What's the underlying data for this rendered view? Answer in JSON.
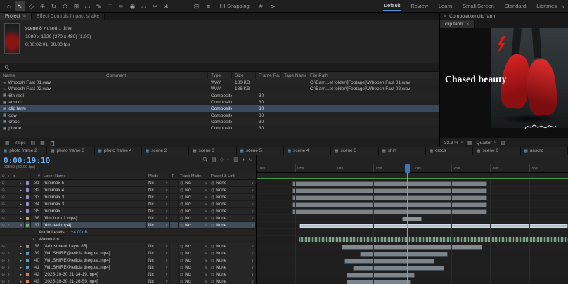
{
  "colors": {
    "accent": "#4a8fd8",
    "timecode_blue": "#6ab0f0",
    "render_bar_green": "#3f9b3f",
    "audio_value_blue": "#4f9fe8",
    "boot_red": "#c01818"
  },
  "toolbar": {
    "tools": [
      {
        "name": "home-icon",
        "glyph": "⌂"
      },
      {
        "name": "selection-tool-icon",
        "glyph": "↖",
        "active": true
      },
      {
        "name": "hand-tool-icon",
        "glyph": "◇"
      },
      {
        "name": "zoom-tool-icon",
        "glyph": "⊕"
      },
      {
        "name": "orbit-camera-tool-icon",
        "glyph": "↻"
      },
      {
        "name": "pan-camera-tool-icon",
        "glyph": "⊙"
      },
      {
        "name": "pan-behind-tool-icon",
        "glyph": "⊞"
      },
      {
        "name": "shape-tool-icon",
        "glyph": "▭"
      },
      {
        "name": "pen-tool-icon",
        "glyph": "✎"
      },
      {
        "name": "type-tool-icon",
        "glyph": "T"
      },
      {
        "name": "brush-tool-icon",
        "glyph": "✏"
      },
      {
        "name": "clone-stamp-tool-icon",
        "glyph": "◉"
      },
      {
        "name": "eraser-tool-icon",
        "glyph": "▱"
      },
      {
        "name": "roto-brush-tool-icon",
        "glyph": "✂"
      },
      {
        "name": "puppet-pin-tool-icon",
        "glyph": "∗"
      }
    ],
    "mid_icons": [
      {
        "name": "align-panel-icon",
        "glyph": "⊟"
      },
      {
        "name": "mask-mode-icon",
        "glyph": "≡"
      }
    ],
    "snapping": {
      "label": "Snapping",
      "checked": false
    },
    "post_icons": [
      {
        "name": "grid-guides-icon",
        "glyph": "#"
      },
      {
        "name": "preview-options-icon",
        "glyph": "⊳"
      }
    ],
    "workspaces": [
      "Default",
      "Review",
      "Learn",
      "Small Screen",
      "Standard",
      "Libraries"
    ],
    "active_workspace": "Default",
    "more_workspaces_glyph": "»"
  },
  "project_panel": {
    "menu_icon": "≡",
    "tab_project": "Project",
    "tab_effect_controls": "Effect Controls Impact shake",
    "selected_item": {
      "name": "scene 8",
      "usage": "used 1 time",
      "dimensions": "1080 x 1920 (270 x 480) (1.00)",
      "duration": "0:00:02:01, 30.00 fps"
    },
    "columns": [
      "Name",
      "Comment",
      "Type",
      "Size",
      "Frame Ra..",
      "Tape Name",
      "File Path"
    ],
    "rows": [
      {
        "name": "Whoosh Fast 01.wav",
        "icon": "audio",
        "type": "WAV",
        "size": "180 KB",
        "file_path": "C:\\Earn...el folder\\[Footage]\\Whoosh Fast 01.wav"
      },
      {
        "name": "Whoosh Fast 02.wav",
        "icon": "audio",
        "type": "WAV",
        "size": "186 KB",
        "file_path": "C:\\Earn...el folder\\[Footage]\\Whoosh Fast 02.wav"
      },
      {
        "name": "6th reel",
        "icon": "comp",
        "type": "Composition",
        "frame_rate": "30"
      },
      {
        "name": "anscro",
        "icon": "comp",
        "type": "Composition",
        "frame_rate": "30"
      },
      {
        "name": "clip farm",
        "icon": "comp",
        "type": "Composition",
        "frame_rate": "30",
        "selected": true
      },
      {
        "name": "cow",
        "icon": "comp",
        "type": "Composition",
        "frame_rate": "30"
      },
      {
        "name": "crocs",
        "icon": "comp",
        "type": "Composition",
        "frame_rate": "30"
      },
      {
        "name": "phone",
        "icon": "comp",
        "type": "Composition",
        "frame_rate": "30"
      }
    ],
    "footer": {
      "bit_depth": "8 bpc"
    }
  },
  "composition_panel": {
    "title": "Composition clip farm",
    "tab": "clip farm",
    "overlay_text": "Chased beauty",
    "zoom": "33.3 %",
    "resolution": "Quarter"
  },
  "comp_tabs": [
    "photo frame 2",
    "photo frame 3",
    "photo frame 4",
    "scene 2",
    "scene 3",
    "scene 5",
    "scene 4",
    "scene 5",
    "shirt",
    "crocs",
    "scene 6",
    "anscro"
  ],
  "timeline": {
    "timecode": "0:00:19:10",
    "frame_info": "00580 (30.00 fps)",
    "visible_range_s": 40,
    "playhead_s": 19.33,
    "ruler": [
      {
        "s": 0,
        "label": "00s"
      },
      {
        "s": 5,
        "label": "05s"
      },
      {
        "s": 10,
        "label": "10s"
      },
      {
        "s": 15,
        "label": "15s"
      },
      {
        "s": 20,
        "label": "20s"
      },
      {
        "s": 25,
        "label": "25s"
      },
      {
        "s": 30,
        "label": "30s"
      },
      {
        "s": 35,
        "label": "35s"
      }
    ],
    "columns": {
      "index": "#",
      "layer_name": "Layer Name",
      "mode": "Mode",
      "t": "T",
      "track_matte": "Track Matte",
      "parent": "Parent & Link"
    },
    "audio_props": {
      "levels_label": "Audio Levels",
      "levels_value": "+4.00dB",
      "waveform_label": "Waveform"
    },
    "layers": [
      {
        "index": 31,
        "name": "minimax 5",
        "color": "#9a8cc8",
        "mode": "Nc",
        "track_matte": "Nc",
        "parent": "None",
        "bar": {
          "s": 4.6,
          "e": 29.6
        },
        "bar_color": "#7d8288"
      },
      {
        "index": 32,
        "name": "minimax 4",
        "color": "#9a8cc8",
        "mode": "Nc",
        "track_matte": "Nc",
        "parent": "None",
        "bar": {
          "s": 4.6,
          "e": 29.6
        },
        "bar_color": "#7d8288"
      },
      {
        "index": 33,
        "name": "minimax 3",
        "color": "#9a8cc8",
        "mode": "Nc",
        "track_matte": "Nc",
        "parent": "None",
        "bar": {
          "s": 4.6,
          "e": 29.6
        },
        "bar_color": "#7d8288"
      },
      {
        "index": 34,
        "name": "minimax 3",
        "color": "#9a8cc8",
        "mode": "Nc",
        "track_matte": "Nc",
        "parent": "None",
        "bar": {
          "s": 4.6,
          "e": 29.6
        },
        "bar_color": "#7d8288"
      },
      {
        "index": 35,
        "name": "minimax",
        "color": "#9a8cc8",
        "mode": "Nc",
        "track_matte": "Nc",
        "parent": "None",
        "bar": {
          "s": 4.6,
          "e": 29.6
        },
        "bar_color": "#7d8288"
      },
      {
        "index": 36,
        "name": "[film burn 1.mp4]",
        "color": "#b8a85f",
        "mode": "Nc",
        "track_matte": "Nc",
        "parent": "None",
        "bar": {
          "s": 18.7,
          "e": 21.2
        },
        "bar_color": "#8f9296"
      },
      {
        "index": 37,
        "name": "[6th reel.mp4]",
        "color": "#6fae6f",
        "mode": "Nc",
        "track_matte": "Nc",
        "parent": "None",
        "audio": true,
        "selected": true,
        "twirl": "▾",
        "bar": {
          "s": 5.5,
          "e": 40
        },
        "bar_color": "#b6c2cb",
        "props": [
          {
            "label": "Audio Levels",
            "value": "+4.00dB"
          },
          {
            "label": "Waveform",
            "waveform": true
          }
        ]
      },
      {
        "index": 38,
        "name": "[Adjustment Layer 85]",
        "color": "#8f8f8f",
        "mode": "Nc",
        "track_matte": "Nc",
        "parent": "None",
        "bar": {
          "s": 10.9,
          "e": 29.0
        },
        "bar_color": "#84898d"
      },
      {
        "index": 39,
        "name": "[WILSHIRE@felicia thegoat.mp4]",
        "color": "#5f93c0",
        "mode": "Nc",
        "track_matte": "Nc",
        "parent": "None",
        "audio": true,
        "bar": {
          "s": 13.3,
          "e": 24.6
        },
        "bar_color": "#79848c"
      },
      {
        "index": 40,
        "name": "[WILSHIRE@felicia thegoat.mp4]",
        "color": "#5f93c0",
        "mode": "Nc",
        "track_matte": "Nc",
        "parent": "None",
        "audio": true,
        "bar": {
          "s": 11.3,
          "e": 22.8
        },
        "bar_color": "#79848c"
      },
      {
        "index": 41,
        "name": "[WILSHIRE@felicia thegoat.mp4]",
        "color": "#5f93c0",
        "mode": "Nc",
        "track_matte": "Nc",
        "parent": "None",
        "audio": true,
        "bar": {
          "s": 12.4,
          "e": 24.1
        },
        "bar_color": "#79848c"
      },
      {
        "index": 42,
        "name": "[2025-10-30 21-34-19.mp4]",
        "color": "#c8855f",
        "mode": "Nc",
        "track_matte": "Nc",
        "parent": "None",
        "audio": true,
        "bar": {
          "s": 11.6,
          "e": 20.3
        },
        "bar_color": "#7a858d"
      },
      {
        "index": 43,
        "name": "[2025-10-30 21-26-59.mp4]",
        "color": "#c8855f",
        "mode": "Nc",
        "track_matte": "Nc",
        "parent": "None",
        "audio": true,
        "bar": {
          "s": 11.6,
          "e": 19.8
        },
        "bar_color": "#7a858d"
      }
    ]
  }
}
